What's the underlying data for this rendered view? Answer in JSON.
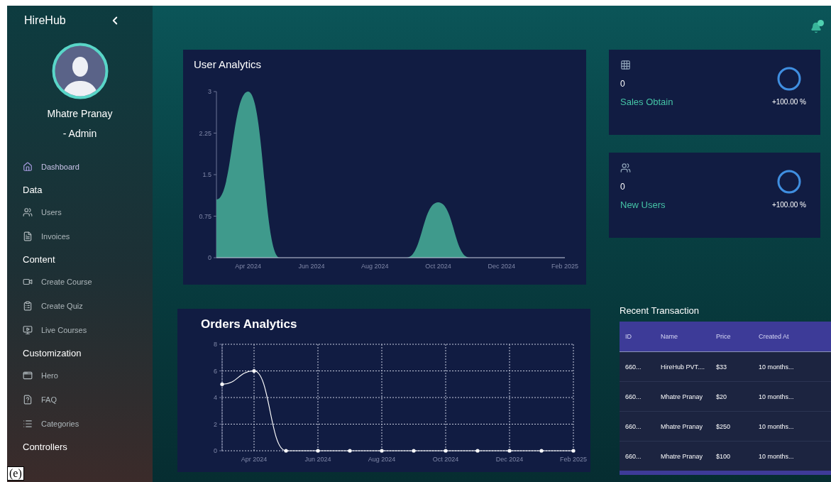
{
  "figure_label": "(e)",
  "sidebar": {
    "brand": "HireHub",
    "user": {
      "name": "Mhatre Pranay",
      "role": "- Admin"
    },
    "items": [
      {
        "kind": "link",
        "label": "Dashboard",
        "selected": true
      },
      {
        "kind": "heading",
        "label": "Data"
      },
      {
        "kind": "link",
        "label": "Users",
        "selected": false
      },
      {
        "kind": "link",
        "label": "Invoices",
        "selected": false
      },
      {
        "kind": "heading",
        "label": "Content"
      },
      {
        "kind": "link",
        "label": "Create Course",
        "selected": false
      },
      {
        "kind": "link",
        "label": "Create Quiz",
        "selected": false
      },
      {
        "kind": "link",
        "label": "Live Courses",
        "selected": false
      },
      {
        "kind": "heading",
        "label": "Customization"
      },
      {
        "kind": "link",
        "label": "Hero",
        "selected": false
      },
      {
        "kind": "link",
        "label": "FAQ",
        "selected": false
      },
      {
        "kind": "link",
        "label": "Categories",
        "selected": false
      },
      {
        "kind": "heading",
        "label": "Controllers"
      }
    ]
  },
  "user_analytics": {
    "title": "User Analytics",
    "chart_data": {
      "type": "area",
      "categories": [
        null,
        "Apr 2024",
        null,
        "Jun 2024",
        null,
        "Aug 2024",
        null,
        "Oct 2024",
        null,
        "Dec 2024",
        null,
        "Feb 2025"
      ],
      "ylim": [
        0,
        3
      ],
      "series": [
        {
          "color": "#3f9a8c",
          "values": [
            1.05,
            3,
            0,
            0,
            0,
            0,
            0,
            1,
            0,
            0,
            0,
            0
          ]
        }
      ],
      "yticks": [
        0,
        0.75,
        1.5,
        2.25,
        3
      ]
    }
  },
  "stats": [
    {
      "value": "0",
      "label": "Sales Obtain",
      "change": "+100.00 %",
      "level": 1
    },
    {
      "value": "0",
      "label": "New Users",
      "change": "+100.00 %",
      "level": 1
    }
  ],
  "orders_analytics": {
    "title": "Orders Analytics",
    "chart_data": {
      "type": "line",
      "categories": [
        null,
        "Apr 2024",
        null,
        "Jun 2024",
        null,
        "Aug 2024",
        null,
        "Oct 2024",
        null,
        "Dec 2024",
        null,
        "Feb 2025"
      ],
      "ylim": [
        0,
        8
      ],
      "series": [
        {
          "color": "#ffffff",
          "values": [
            5,
            6,
            0,
            0,
            0,
            0,
            0,
            0,
            0,
            0,
            0,
            0
          ]
        }
      ],
      "yticks": [
        0,
        2,
        4,
        6,
        8
      ],
      "grid": true
    }
  },
  "recent_transactions": {
    "title": "Recent Transaction",
    "columns": [
      "ID",
      "Name",
      "Price",
      "Created At"
    ],
    "rows": [
      [
        "660...",
        "HireHub PVT....",
        "$33",
        "10 months..."
      ],
      [
        "660...",
        "Mhatre Pranay",
        "$20",
        "10 months..."
      ],
      [
        "660...",
        "Mhatre Pranay",
        "$250",
        "10 months..."
      ],
      [
        "660...",
        "Mhatre Pranay",
        "$100",
        "10 months..."
      ]
    ]
  }
}
